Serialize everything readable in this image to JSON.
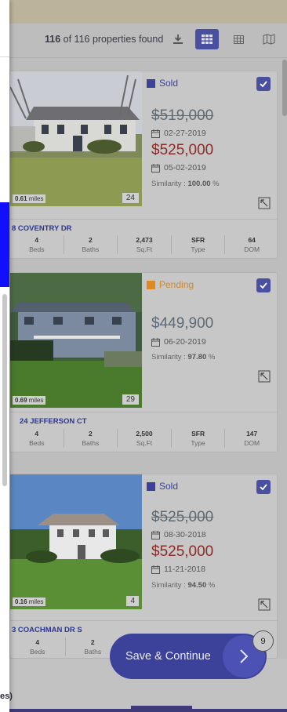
{
  "toolbar": {
    "count_bold": "116",
    "count_rest": " of 116 properties found",
    "icons": [
      "download-icon",
      "grid-view-icon",
      "table-view-icon",
      "map-view-icon"
    ]
  },
  "colors": {
    "accent": "#4a4fa0",
    "sold": "#3c4199",
    "pending": "#e08a1e",
    "new_price": "#8c2a2a",
    "address": "#2b3690"
  },
  "properties": [
    {
      "status": "Sold",
      "original_price": "$519,000",
      "list_date": "02-27-2019",
      "price": "$525,000",
      "sold_date": "05-02-2019",
      "similarity_label": "Similarity : ",
      "similarity_value": "100.00",
      "similarity_unit": " %",
      "distance_value": "0.61",
      "distance_unit": " miles",
      "photo_count": "24",
      "address": "8 COVENTRY DR",
      "beds": "4",
      "beds_label": "Beds",
      "baths": "2",
      "baths_label": "Baths",
      "sqft": "2,473",
      "sqft_label": "Sq.Ft",
      "type": "SFR",
      "type_label": "Type",
      "dom": "64",
      "dom_label": "DOM"
    },
    {
      "status": "Pending",
      "price": "$449,900",
      "list_date": "06-20-2019",
      "similarity_label": "Similarity : ",
      "similarity_value": "97.80",
      "similarity_unit": " %",
      "distance_value": "0.69",
      "distance_unit": " miles",
      "photo_count": "29",
      "address": "24 JEFFERSON CT",
      "beds": "4",
      "beds_label": "Beds",
      "baths": "2",
      "baths_label": "Baths",
      "sqft": "2,500",
      "sqft_label": "Sq.Ft",
      "type": "SFR",
      "type_label": "Type",
      "dom": "147",
      "dom_label": "DOM"
    },
    {
      "status": "Sold",
      "original_price": "$525,000",
      "list_date": "08-30-2018",
      "price": "$525,000",
      "sold_date": "11-21-2018",
      "similarity_label": "Similarity : ",
      "similarity_value": "94.50",
      "similarity_unit": " %",
      "distance_value": "0.16",
      "distance_unit": " miles",
      "photo_count": "4",
      "address": "3 COACHMAN DR S",
      "beds": "4",
      "beds_label": "Beds",
      "baths": "2",
      "baths_label": "Baths"
    }
  ],
  "save_button": {
    "label": "Save & Continue"
  },
  "selected_badge": "9",
  "drawer_text": "es)"
}
